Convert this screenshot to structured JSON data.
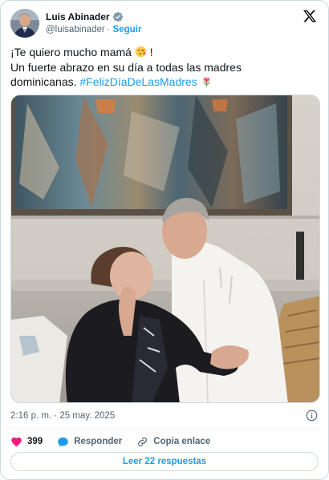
{
  "author": {
    "name": "Luis Abinader",
    "handle": "@luisabinader",
    "separator": "·",
    "follow_label": "Seguir"
  },
  "tweet": {
    "line1": "¡Te quiero mucho mamá",
    "line1_end": "!",
    "line2": "Un fuerte abrazo en su día a todas las madres",
    "line3_prefix": "dominicanas. ",
    "hashtag": "#FelizDíaDeLasMadres"
  },
  "icons": {
    "verified": "verified-badge-icon",
    "x_logo": "x-logo-icon",
    "kiss_emoji": "face-blowing-kiss-emoji",
    "tulip_emoji": "tulip-emoji",
    "info": "info-icon",
    "like": "heart-icon",
    "reply": "speech-bubble-icon",
    "link": "link-icon"
  },
  "meta": {
    "timestamp": "2:16 p. m. · 25 may. 2025"
  },
  "actions": {
    "likes_count": "399",
    "reply_label": "Responder",
    "copy_label": "Copia enlace"
  },
  "replies_button": "Leer 22 respuestas",
  "colors": {
    "accent": "#1d9bf0",
    "like": "#f91880",
    "muted": "#536471",
    "border": "#cfd9de"
  }
}
